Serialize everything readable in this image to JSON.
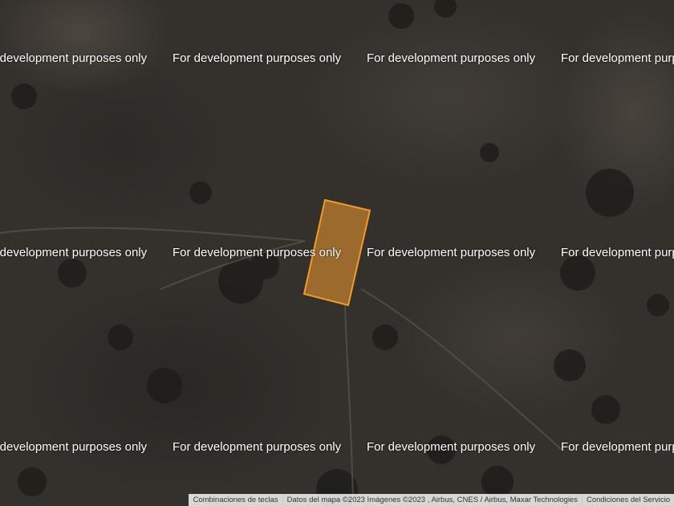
{
  "map": {
    "view": "satellite",
    "watermark_text": "For development purposes only",
    "parcel": {
      "stroke_color": "#f29a2e",
      "fill_color": "#f29a2e",
      "fill_opacity": 0.55
    }
  },
  "attribution": {
    "shortcuts": "Combinaciones de teclas",
    "map_data": "Datos del mapa ©2023 Imágenes ©2023 , Airbus, CNES / Airbus, Maxar Technologies",
    "terms": "Condiciones del Servicio"
  }
}
